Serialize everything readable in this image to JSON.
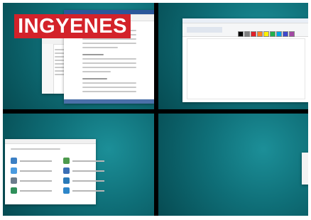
{
  "banner": {
    "text": "INGYENES"
  },
  "colors": {
    "banner_bg": "#d3222a",
    "banner_text": "#ffffff",
    "wallpaper_teal": "#0d6b72",
    "flower_red": "#e1212a"
  },
  "panes": [
    {
      "name": "top-left",
      "content": [
        "word-document-window",
        "file-explorer-window"
      ]
    },
    {
      "name": "top-right",
      "content": [
        "paint-window"
      ]
    },
    {
      "name": "bottom-left",
      "content": [
        "control-panel-window"
      ]
    },
    {
      "name": "bottom-right",
      "content": [
        "desktop-wallpaper",
        "partial-window"
      ]
    }
  ]
}
